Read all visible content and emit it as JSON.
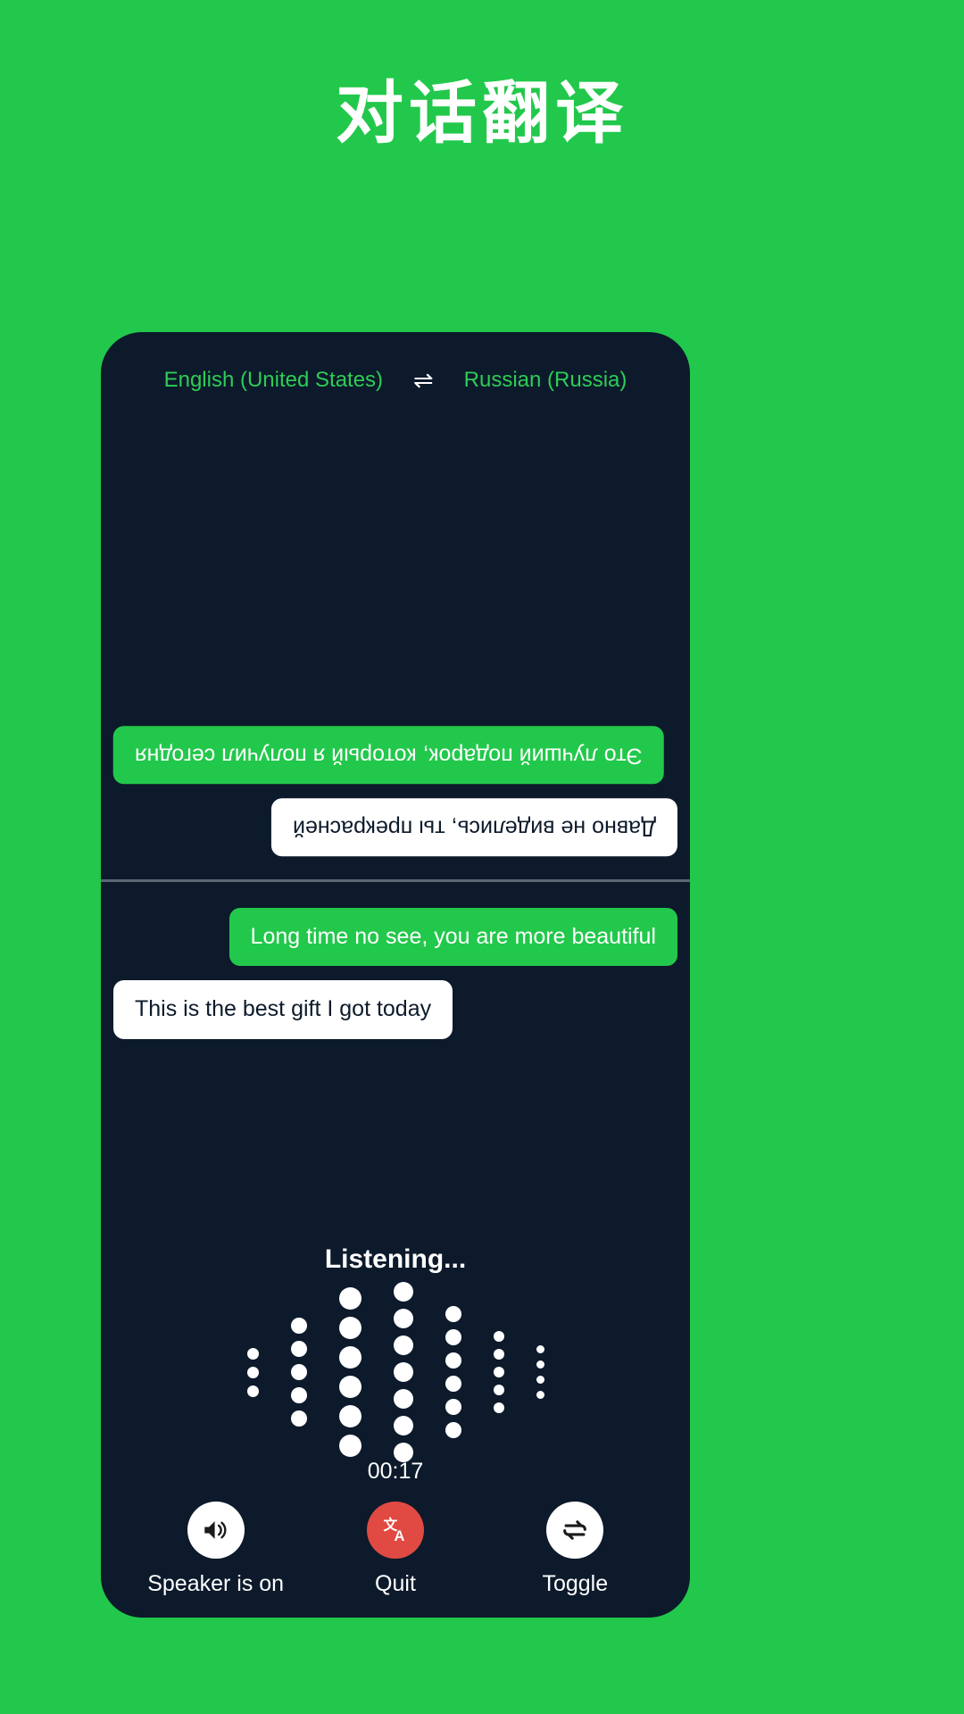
{
  "page": {
    "title": "对话翻译",
    "background_color": "#22c84b",
    "card_background_color": "#0c1a2b",
    "accent_green": "#22c84b",
    "danger_red": "#e04a42"
  },
  "language_bar": {
    "source_language": "English (United States)",
    "swap_icon": "swap-horizontal-icon",
    "swap_glyph": "⇌",
    "target_language": "Russian (Russia)"
  },
  "conversation": {
    "remote_panel_messages": [
      {
        "text": "Это лучший подарок, который я получил сегодня",
        "style": "green",
        "align": "left",
        "rotated": true
      },
      {
        "text": "Давно не виделись, ты прекрасней",
        "style": "white",
        "align": "right",
        "rotated": true
      }
    ],
    "local_panel_messages": [
      {
        "text": "Long time no see, you are more beautiful",
        "style": "green",
        "align": "right",
        "rotated": false
      },
      {
        "text": "This is the best gift I got today",
        "style": "white",
        "align": "left",
        "rotated": false
      }
    ]
  },
  "status": {
    "listening_label": "Listening...",
    "timer": "00:17"
  },
  "waveform": {
    "columns": [
      {
        "count": 3,
        "size": 13
      },
      {
        "count": 5,
        "size": 18
      },
      {
        "count": 6,
        "size": 25
      },
      {
        "count": 7,
        "size": 22
      },
      {
        "count": 6,
        "size": 18
      },
      {
        "count": 5,
        "size": 12
      },
      {
        "count": 4,
        "size": 9
      }
    ]
  },
  "controls": [
    {
      "label": "Speaker is on",
      "icon": "speaker-on-icon",
      "style": "light"
    },
    {
      "label": "Quit",
      "icon": "translate-icon",
      "style": "danger"
    },
    {
      "label": "Toggle",
      "icon": "swap-repeat-icon",
      "style": "light"
    }
  ]
}
